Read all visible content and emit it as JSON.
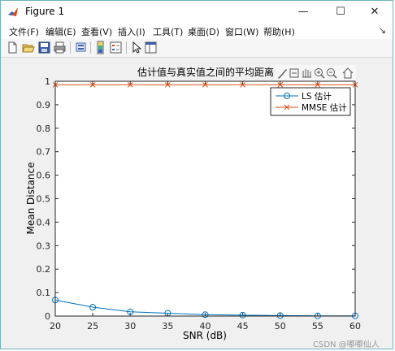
{
  "window": {
    "title": "Figure 1",
    "minimize_glyph": "—",
    "maximize_glyph": "☐",
    "close_glyph": "✕"
  },
  "menu": {
    "items": [
      "文件(F)",
      "编辑(E)",
      "查看(V)",
      "插入(I)",
      "工具(T)",
      "桌面(D)",
      "窗口(W)",
      "帮助(H)"
    ],
    "overflow_glyph": "↘"
  },
  "toolbar": {
    "icons": [
      "new-figure-icon",
      "open-file-icon",
      "save-icon",
      "print-icon",
      "print-preview-icon",
      "colorbar-icon",
      "legend-icon",
      "pointer-icon",
      "property-editor-icon"
    ]
  },
  "axes_toolbar": {
    "icons": [
      "brush-icon",
      "export-icon",
      "pan-icon",
      "zoom-in-icon",
      "zoom-out-icon",
      "home-icon"
    ]
  },
  "chart_data": {
    "type": "line",
    "title": "估计值与真实值之间的平均距离",
    "xlabel": "SNR (dB)",
    "ylabel": "Mean Distance",
    "xlim": [
      20,
      60
    ],
    "ylim": [
      0,
      1
    ],
    "xticks": [
      "20",
      "25",
      "30",
      "35",
      "40",
      "45",
      "50",
      "55",
      "60"
    ],
    "yticks": [
      "0",
      "0.1",
      "0.2",
      "0.3",
      "0.4",
      "0.5",
      "0.6",
      "0.7",
      "0.8",
      "0.9",
      "1"
    ],
    "x": [
      20,
      25,
      30,
      35,
      40,
      45,
      50,
      55,
      60
    ],
    "series": [
      {
        "name": "LS 估计",
        "color": "#0072BD",
        "marker": "circle",
        "values": [
          0.068,
          0.038,
          0.018,
          0.012,
          0.006,
          0.004,
          0.002,
          0.001,
          0.001
        ]
      },
      {
        "name": "MMSE 估计",
        "color": "#D95319",
        "marker": "cross",
        "values": [
          0.985,
          0.985,
          0.985,
          0.985,
          0.985,
          0.985,
          0.985,
          0.985,
          0.985
        ]
      }
    ],
    "legend_position": "top-right",
    "grid": false
  },
  "watermark": "CSDN @嘟嘟仙人"
}
